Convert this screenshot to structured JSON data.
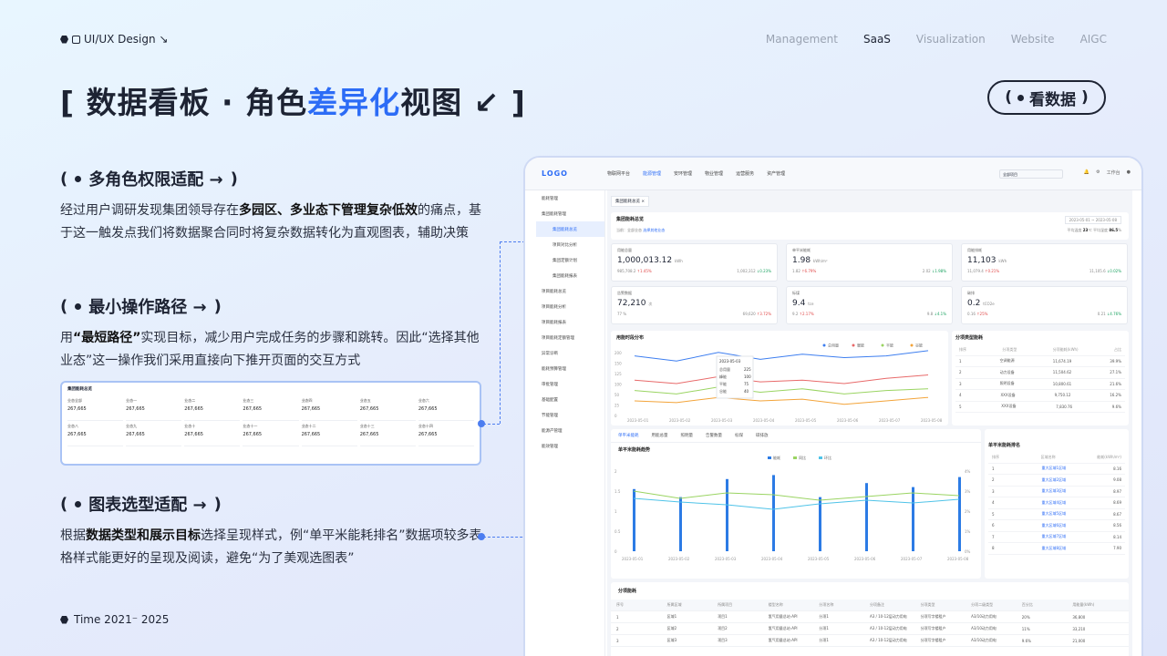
{
  "header": {
    "brand": "UI/UX Design ↘",
    "nav": [
      "Management",
      "SaaS",
      "Visualization",
      "Website",
      "AIGC"
    ],
    "nav_active": "SaaS"
  },
  "title": {
    "pre": "[ 数据看板 · 角色",
    "hl": "差异化",
    "post": "视图 ↙ ]"
  },
  "view_button": "看数据",
  "sections": [
    {
      "heading": "多角色权限适配 →",
      "text": "经过用户调研发现集团领导存在<b>多园区、多业态下管理复杂低效</b>的痛点，基于这一触发点我们将数据聚合同时将复杂数据转化为直观图表，辅助决策"
    },
    {
      "heading": "最小操作路径 →",
      "text": "用<b>“最短路径”</b>实现目标，减少用户完成任务的步骤和跳转。因此“选择其他业态”这一操作我们采用直接向下推开页面的交互方式"
    },
    {
      "heading": "图表选型适配 →",
      "text": "根据<b>数据类型和展示目标</b>选择呈现样式，例“单平米能耗排名”数据项较多表格样式能更好的呈现及阅读，避免“为了美观选图表”"
    }
  ],
  "mini": {
    "title": "集团能耗总览",
    "row1": [
      "业态全部",
      "业态一",
      "业态二",
      "业态三",
      "业态四",
      "业态五",
      "业态六"
    ],
    "row2": [
      "业态八",
      "业态九",
      "业态十",
      "业态十一",
      "业态十二",
      "业态十三",
      "业态十四"
    ],
    "value": "267,665"
  },
  "footer": "Time 2021⁻ 2025",
  "app": {
    "logo": "LOGO",
    "tabs": [
      "物联网平台",
      "能源管理",
      "安环管理",
      "物业管理",
      "运营服务",
      "资产管理"
    ],
    "tab_active": "能源管理",
    "top_select": "全部项目",
    "top_right": "工作台",
    "sidebar": [
      {
        "label": "能耗管理",
        "sub": false,
        "act": false
      },
      {
        "label": "集团能耗管理",
        "sub": false,
        "act": false
      },
      {
        "label": "集团能耗总览",
        "sub": true,
        "act": true
      },
      {
        "label": "项目对比分析",
        "sub": true,
        "act": false
      },
      {
        "label": "集团定额计划",
        "sub": true,
        "act": false
      },
      {
        "label": "集团能耗报表",
        "sub": true,
        "act": false
      },
      {
        "label": "项目能耗总览",
        "sub": false,
        "act": false
      },
      {
        "label": "项目能耗分析",
        "sub": false,
        "act": false
      },
      {
        "label": "项目能耗报表",
        "sub": false,
        "act": false
      },
      {
        "label": "项目能耗定额管理",
        "sub": false,
        "act": false
      },
      {
        "label": "异常诊断",
        "sub": false,
        "act": false
      },
      {
        "label": "能耗预算管理",
        "sub": false,
        "act": false
      },
      {
        "label": "审批管理",
        "sub": false,
        "act": false
      },
      {
        "label": "基础配置",
        "sub": false,
        "act": false
      },
      {
        "label": "节能管理",
        "sub": false,
        "act": false
      },
      {
        "label": "能源产管理",
        "sub": false,
        "act": false
      },
      {
        "label": "能效管理",
        "sub": false,
        "act": false
      }
    ],
    "crumb": "集团能耗总览 ×",
    "overview": {
      "title": "集团能耗总览",
      "scope": "当前：全部业态",
      "switch": "选择其他业态",
      "temp_label": "平均温度",
      "temp": "23",
      "hum_label": "平均湿度",
      "hum": "86.5",
      "date": "2023-05-01 ~ 2023-05-08"
    },
    "kpis": [
      {
        "label": "用能总量",
        "value": "1,000,013.12",
        "unit": "kWh",
        "left": "985,708.2",
        "lchg": "↑1.45%",
        "right": "1,002,312",
        "rchg": "↓0.23%"
      },
      {
        "label": "单平米能耗",
        "value": "1.98",
        "unit": "kWh/m²",
        "left": "1.82",
        "lchg": "↑6.79%",
        "right": "2.02",
        "rchg": "↓1.98%"
      },
      {
        "label": "用能排耗",
        "value": "11,103",
        "unit": "kWh",
        "left": "11,079.4",
        "lchg": "↑0.21%",
        "right": "11,105.6",
        "rchg": "↓0.02%"
      },
      {
        "label": "告警数据",
        "value": "72,210",
        "unit": "次",
        "left": "77 %",
        "lchg": "",
        "right": "69,620",
        "rchg": "↑3.72%"
      },
      {
        "label": "标煤",
        "value": "9.4",
        "unit": "tce",
        "left": "9.2",
        "lchg": "↑2.17%",
        "right": "9.8",
        "rchg": "↓4.1%"
      },
      {
        "label": "碳排",
        "value": "0.2",
        "unit": "tCO2e",
        "left": "0.16",
        "lchg": "↑25%",
        "right": "0.21",
        "rchg": "↓4.76%"
      }
    ],
    "trend": {
      "title": "用能时段分布",
      "legend": [
        "总用量",
        "暖能",
        "平能",
        "谷能"
      ],
      "dates": [
        "2023-05-01",
        "2023-05-02",
        "2023-05-03",
        "2023-05-04",
        "2023-05-05",
        "2023-05-06",
        "2023-05-07",
        "2023-05-08"
      ],
      "yticks": [
        "200",
        "150",
        "125",
        "100",
        "50",
        "25",
        "0"
      ],
      "tooltip": {
        "date": "2023-05-03",
        "rows": [
          [
            "总用量",
            "225"
          ],
          [
            "峰能",
            "100"
          ],
          [
            "平能",
            "75"
          ],
          [
            "谷能",
            "40"
          ]
        ]
      }
    },
    "category": {
      "title": "分项类型能耗",
      "head": [
        "排序",
        "分项类型",
        "分项能耗(kWh)",
        "占比"
      ],
      "rows": [
        [
          "1",
          "空调能源",
          "11,674.19",
          "39.9%"
        ],
        [
          "2",
          "动力设备",
          "11,504.62",
          "27.1%"
        ],
        [
          "3",
          "照明设备",
          "10,800.61",
          "21.6%"
        ],
        [
          "4",
          "XXX设备",
          "9,750.12",
          "16.2%"
        ],
        [
          "5",
          "XXX设备",
          "7,830.76",
          "9.6%"
        ]
      ]
    },
    "tabs2": [
      "单平米能耗",
      "用能总量",
      "照明量",
      "告警数量",
      "标煤",
      "碳排放"
    ],
    "bar": {
      "title": "单平米能耗趋势",
      "legend": [
        "能耗",
        "同比",
        "环比"
      ],
      "dates": [
        "2023-05-01",
        "2023-05-02",
        "2023-05-03",
        "2023-05-04",
        "2023-05-05",
        "2023-05-06",
        "2023-05-07",
        "2023-05-08"
      ],
      "unit": "kWh",
      "yticks": [
        "2",
        "1.5",
        "1",
        "0.5",
        "0"
      ],
      "y2ticks": [
        "4%",
        "3%",
        "2%",
        "1%",
        "0%"
      ]
    },
    "ranking": {
      "title": "单平米能耗排名",
      "filters": [
        "城市",
        "片区",
        "项目"
      ],
      "link": "项目列表",
      "head": [
        "排序",
        "区域名称",
        "能耗(kWh/m²)"
      ],
      "rows": [
        [
          "1",
          "重大区域1区域",
          "8.16"
        ],
        [
          "2",
          "重大区域2区域",
          "9.08"
        ],
        [
          "3",
          "重大区域3区域",
          "8.97"
        ],
        [
          "4",
          "重大区域4区域",
          "8.69"
        ],
        [
          "5",
          "重大区域5区域",
          "8.67"
        ],
        [
          "6",
          "重大区域6区域",
          "8.56"
        ],
        [
          "7",
          "重大区域7区域",
          "8.14"
        ],
        [
          "8",
          "重大区域8区域",
          "7.90"
        ]
      ]
    },
    "table": {
      "title": "分项能耗",
      "filters": [
        "全部",
        "<50%",
        ">50%"
      ],
      "export": "导出",
      "head": [
        "序号",
        "所属区域",
        "所属项目",
        "楼型名称",
        "分项名称",
        "分项备注",
        "分项类型",
        "分项二级类型",
        "百分比",
        "用能量(kWh)"
      ],
      "rows": [
        [
          "1",
          "区域1",
          "项目1",
          "氢气用量总站-API",
          "分项1",
          "A3 / 10-12层动力用电",
          "分项写字楼租户",
          "A3/10动力用电",
          "20%",
          "36,800"
        ],
        [
          "2",
          "区域2",
          "项目2",
          "氢气用量总站-API",
          "分项1",
          "A3 / 10-12层动力用电",
          "分项写字楼租户",
          "A3/10动力用电",
          "11%",
          "33,210"
        ],
        [
          "3",
          "区域3",
          "项目3",
          "氢气用量总站-API",
          "分项1",
          "A3 / 10-12层动力用电",
          "分项写字楼租户",
          "A3/10动力用电",
          "9.6%",
          "21,000"
        ]
      ]
    }
  }
}
